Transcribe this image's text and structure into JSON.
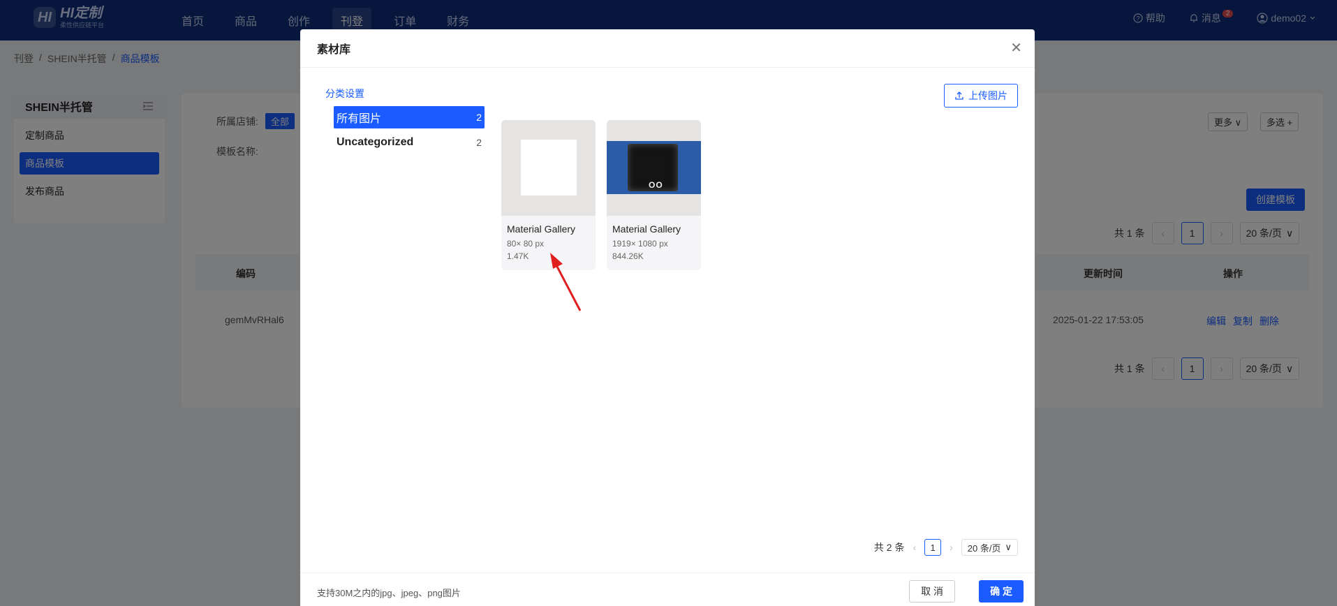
{
  "logo": {
    "mark": "HI",
    "title": "HI定制",
    "subtitle": "柔性供应链平台"
  },
  "nav": {
    "items": [
      "首页",
      "商品",
      "创作",
      "刊登",
      "订单",
      "财务"
    ],
    "help": "帮助",
    "messages": "消息",
    "message_count": "2",
    "user": "demo02"
  },
  "breadcrumb": [
    "刊登",
    "/",
    "SHEIN半托管",
    "/",
    "商品模板"
  ],
  "sidebar": {
    "title": "SHEIN半托管",
    "items": [
      "定制商品",
      "商品模板",
      "发布商品"
    ]
  },
  "main": {
    "store_label": "所属店铺:",
    "store_all": "全部",
    "template_name_label": "模板名称:",
    "more": "更多",
    "multi": "多选",
    "create": "创建模板",
    "total": "共 1 条",
    "page": "1",
    "page_size": "20 条/页",
    "columns": {
      "code": "编码",
      "updated": "更新时间",
      "actions": "操作"
    },
    "row": {
      "code": "gemMvRHal6",
      "updated": "2025-01-22 17:53:05",
      "edit": "编辑",
      "copy": "复制",
      "delete": "删除"
    }
  },
  "modal": {
    "title": "素材库",
    "category_setting": "分类设置",
    "upload": "上传图片",
    "categories": [
      {
        "name": "所有图片",
        "count": "2"
      },
      {
        "name": "Uncategorized",
        "count": "2"
      }
    ],
    "images": [
      {
        "name": "Material Gallery",
        "size": "80× 80 px",
        "file": "1.47K"
      },
      {
        "name": "Material Gallery",
        "size": "1919× 1080 px",
        "file": "844.26K",
        "thumb_text": "OO"
      }
    ],
    "total": "共 2 条",
    "page": "1",
    "page_size": "20 条/页",
    "footer_note": "支持30M之内的jpg、jpeg、png图片",
    "cancel": "取 消",
    "ok": "确 定"
  }
}
